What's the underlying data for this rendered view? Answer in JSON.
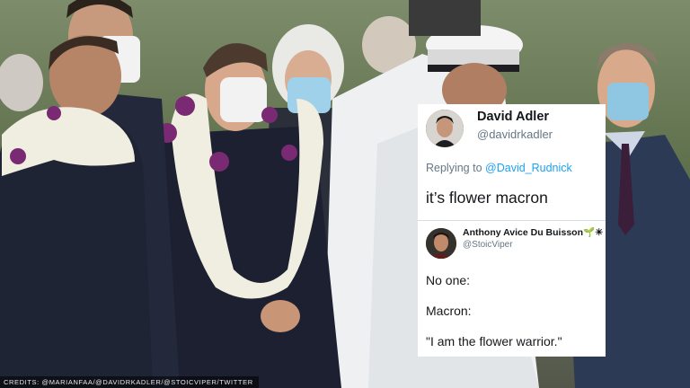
{
  "tweets": [
    {
      "name": "David Adler",
      "handle": "@davidrkadler",
      "reply_prefix": "Replying to",
      "reply_to": "@David_Rudnick",
      "text": "it’s flower macron"
    },
    {
      "name": "Anthony Avice Du Buisson🌱☀",
      "handle": "@StoicViper",
      "lines": [
        "No one:",
        "Macron:",
        "\"I am the flower warrior.\""
      ]
    }
  ],
  "credits": "CREDITS: @MARIANFAA/@DAVIDRKADLER/@STOICVIPER/TWITTER",
  "colors": {
    "twitter_blue": "#1da1f2",
    "muted_gray": "#657786",
    "text": "#14171a"
  }
}
